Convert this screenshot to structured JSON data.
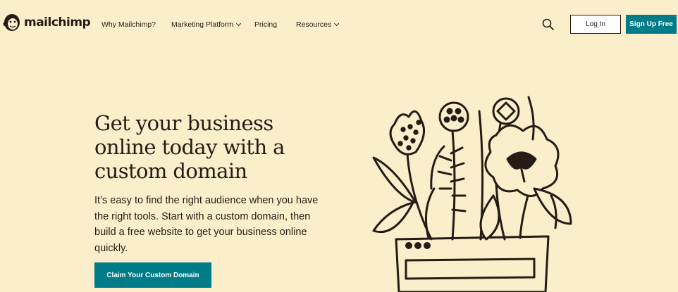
{
  "nav": {
    "logo_text": "mailchimp",
    "links": [
      {
        "label": "Why Mailchimp?",
        "has_dropdown": false
      },
      {
        "label": "Marketing Platform",
        "has_dropdown": true
      },
      {
        "label": "Pricing",
        "has_dropdown": false
      },
      {
        "label": "Resources",
        "has_dropdown": true
      }
    ],
    "search_icon": "search-icon",
    "login_label": "Log In",
    "signup_label": "Sign Up Free"
  },
  "hero": {
    "title": "Get your business online today with a custom domain",
    "subtitle": "It’s easy to find the right audience when you have the right tools. Start with a custom domain, then build a free website to get your business online quickly.",
    "cta_label": "Claim Your Custom Domain"
  },
  "colors": {
    "background": "#fbeecb",
    "brand_teal": "#007c89",
    "ink": "#241c15"
  }
}
